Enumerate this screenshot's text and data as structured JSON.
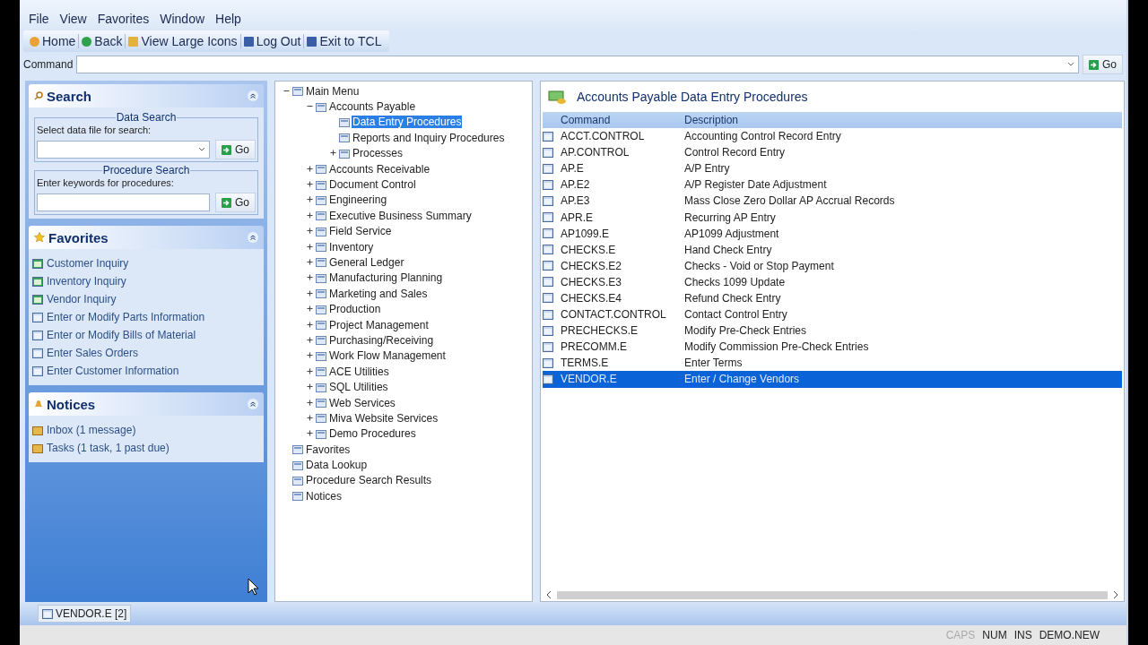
{
  "menu": [
    "File",
    "View",
    "Favorites",
    "Window",
    "Help"
  ],
  "toolbar": [
    "Home",
    "Back",
    "View Large Icons",
    "Log Out",
    "Exit to TCL"
  ],
  "command": {
    "label": "Command",
    "button": "Go"
  },
  "search": {
    "title": "Search",
    "data_search": {
      "legend": "Data Search",
      "label": "Select data file for search:",
      "button": "Go"
    },
    "procedure_search": {
      "legend": "Procedure Search",
      "label": "Enter keywords for procedures:",
      "button": "Go"
    }
  },
  "favorites": {
    "title": "Favorites",
    "items": [
      {
        "label": "Customer Inquiry",
        "kind": "inquiry"
      },
      {
        "label": "Inventory Inquiry",
        "kind": "inquiry"
      },
      {
        "label": "Vendor Inquiry",
        "kind": "inquiry"
      },
      {
        "label": "Enter or Modify Parts Information",
        "kind": "entry"
      },
      {
        "label": "Enter or Modify Bills of Material",
        "kind": "entry"
      },
      {
        "label": "Enter Sales Orders",
        "kind": "entry"
      },
      {
        "label": "Enter Customer Information",
        "kind": "entry"
      }
    ]
  },
  "notices": {
    "title": "Notices",
    "items": [
      "Inbox (1 message)",
      "Tasks (1 task, 1 past due)"
    ]
  },
  "tree": [
    {
      "label": "Main Menu",
      "expanded": true,
      "selected": false,
      "children": [
        {
          "label": "Accounts Payable",
          "expanded": true,
          "selected": false,
          "children": [
            {
              "label": "Data Entry Procedures",
              "selected": true
            },
            {
              "label": "Reports and Inquiry Procedures",
              "selected": false
            },
            {
              "label": "Processes",
              "expanded": false,
              "selected": false
            }
          ]
        },
        {
          "label": "Accounts Receivable",
          "expanded": false,
          "selected": false
        },
        {
          "label": "Document Control",
          "expanded": false,
          "selected": false
        },
        {
          "label": "Engineering",
          "expanded": false,
          "selected": false
        },
        {
          "label": "Executive Business Summary",
          "expanded": false,
          "selected": false
        },
        {
          "label": "Field Service",
          "expanded": false,
          "selected": false
        },
        {
          "label": "Inventory",
          "expanded": false,
          "selected": false
        },
        {
          "label": "General Ledger",
          "expanded": false,
          "selected": false
        },
        {
          "label": "Manufacturing Planning",
          "expanded": false,
          "selected": false
        },
        {
          "label": "Marketing and Sales",
          "expanded": false,
          "selected": false
        },
        {
          "label": "Production",
          "expanded": false,
          "selected": false
        },
        {
          "label": "Project Management",
          "expanded": false,
          "selected": false
        },
        {
          "label": "Purchasing/Receiving",
          "expanded": false,
          "selected": false
        },
        {
          "label": "Work Flow Management",
          "expanded": false,
          "selected": false
        },
        {
          "label": "ACE Utilities",
          "expanded": false,
          "selected": false
        },
        {
          "label": "SQL Utilities",
          "expanded": false,
          "selected": false
        },
        {
          "label": "Web Services",
          "expanded": false,
          "selected": false
        },
        {
          "label": "Miva Website Services",
          "expanded": false,
          "selected": false
        },
        {
          "label": "Demo Procedures",
          "expanded": false,
          "selected": false
        }
      ]
    },
    {
      "label": "Favorites",
      "selected": false
    },
    {
      "label": "Data Lookup",
      "selected": false
    },
    {
      "label": "Procedure Search Results",
      "selected": false
    },
    {
      "label": "Notices",
      "selected": false
    }
  ],
  "procedures": {
    "title": "Accounts Payable Data Entry Procedures",
    "columns": [
      "Command",
      "Description"
    ],
    "rows": [
      {
        "command": "ACCT.CONTROL",
        "description": "Accounting Control Record Entry",
        "selected": false
      },
      {
        "command": "AP.CONTROL",
        "description": "Control Record Entry",
        "selected": false
      },
      {
        "command": "AP.E",
        "description": "A/P Entry",
        "selected": false
      },
      {
        "command": "AP.E2",
        "description": "A/P Register Date Adjustment",
        "selected": false
      },
      {
        "command": "AP.E3",
        "description": "Mass Close Zero Dollar AP Accrual Records",
        "selected": false
      },
      {
        "command": "APR.E",
        "description": "Recurring AP Entry",
        "selected": false
      },
      {
        "command": "AP1099.E",
        "description": "AP1099 Adjustment",
        "selected": false
      },
      {
        "command": "CHECKS.E",
        "description": "Hand Check Entry",
        "selected": false
      },
      {
        "command": "CHECKS.E2",
        "description": "Checks - Void or Stop Payment",
        "selected": false
      },
      {
        "command": "CHECKS.E3",
        "description": "Checks 1099 Update",
        "selected": false
      },
      {
        "command": "CHECKS.E4",
        "description": "Refund Check Entry",
        "selected": false
      },
      {
        "command": "CONTACT.CONTROL",
        "description": "Contact Control Entry",
        "selected": false
      },
      {
        "command": "PRECHECKS.E",
        "description": "Modify Pre-Check Entries",
        "selected": false
      },
      {
        "command": "PRECOMM.E",
        "description": "Modify Commission Pre-Check Entries",
        "selected": false
      },
      {
        "command": "TERMS.E",
        "description": "Enter Terms",
        "selected": false
      },
      {
        "command": "VENDOR.E",
        "description": "Enter / Change Vendors",
        "selected": true
      }
    ]
  },
  "taskbar": [
    "VENDOR.E [2]"
  ],
  "status": {
    "keys": [
      {
        "label": "CAPS",
        "on": false
      },
      {
        "label": "NUM",
        "on": true
      },
      {
        "label": "INS",
        "on": true
      }
    ],
    "account": "DEMO.NEW"
  }
}
